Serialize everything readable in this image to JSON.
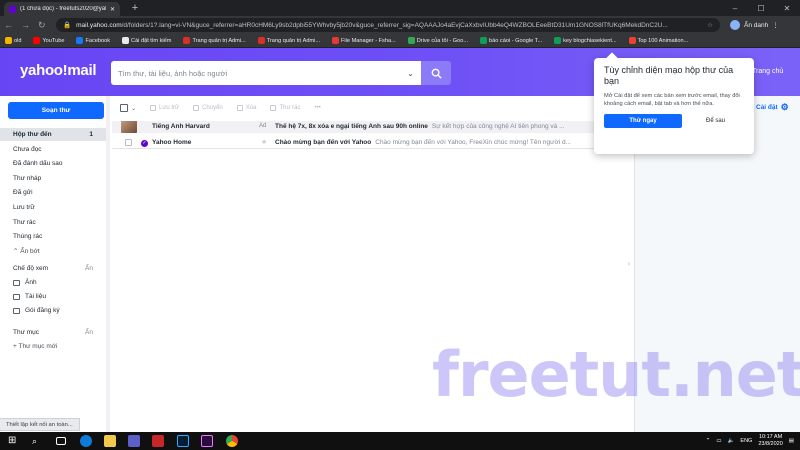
{
  "browser": {
    "tab_title": "(1 chưa đọc) - freetuts2020@yah…",
    "url_domain": "mail.yahoo.com",
    "url_path": "/d/folders/1?.lang=vi-VN&guce_referrer=aHR0cHM6Ly9sb2dpbi55YWhvby5jb20v&guce_referrer_sig=AQAAAJo4aEvjCaXxbvIUbb4eQ4WZBOLEeeBtD31Um1GNOS8lTfUKq6MekdDnC2U...",
    "profile_label": "Ẩn danh",
    "bookmarks": [
      {
        "label": "old",
        "color": "#f4b400"
      },
      {
        "label": "YouTube",
        "color": "#ff0000"
      },
      {
        "label": "Facebook",
        "color": "#1877f2"
      },
      {
        "label": "Cài đặt tìm kiếm",
        "color": "#e8eaed"
      },
      {
        "label": "Trang quản trị Admi...",
        "color": "#d93025"
      },
      {
        "label": "Trang quản trị Admi...",
        "color": "#d93025"
      },
      {
        "label": "File Manager - Fsha...",
        "color": "#e53935"
      },
      {
        "label": "Drive của tôi - Goo...",
        "color": "#34a853"
      },
      {
        "label": "báo cáoi - Google T...",
        "color": "#0f9d58"
      },
      {
        "label": "key blogchiasekient...",
        "color": "#0f9d58"
      },
      {
        "label": "Top 100 Animation...",
        "color": "#ea4335"
      }
    ]
  },
  "header": {
    "logo": "yahoo!mail",
    "search_placeholder": "Tìm thư, tài liệu, ảnh hoặc người",
    "home_link": "Trang chủ"
  },
  "sidebar": {
    "compose": "Soạn thư",
    "folders": [
      {
        "label": "Hộp thư đến",
        "count": "1"
      },
      {
        "label": "Chưa đọc",
        "count": ""
      },
      {
        "label": "Đã đánh dấu sao",
        "count": ""
      },
      {
        "label": "Thư nháp",
        "count": ""
      },
      {
        "label": "Đã gửi",
        "count": ""
      },
      {
        "label": "Lưu trữ",
        "count": ""
      },
      {
        "label": "Thư rác",
        "count": ""
      },
      {
        "label": "Thùng rác",
        "count": ""
      },
      {
        "label": "⌃ Ẩn bớt",
        "count": ""
      }
    ],
    "views_header": "Chế độ xem",
    "views_hide": "Ẩn",
    "views": [
      "Ảnh",
      "Tài liệu",
      "Gói đăng ký"
    ],
    "folders_header": "Thư mục",
    "folders_hide": "Ẩn",
    "new_folder": "+ Thư mục mới"
  },
  "toolbar": {
    "items": [
      "Lưu trữ",
      "Chuyển",
      "Xóa",
      "Thư rác",
      "•••"
    ]
  },
  "messages": [
    {
      "sender": "Tiếng Anh Harvard",
      "ad": "Ad",
      "subject": "Thế hệ 7x, 8x xóa e ngại tiếng Anh sau 90h online",
      "snippet": "Sự kết hợp của công nghệ AI tiên phong và ..."
    },
    {
      "sender": "Yahoo Home",
      "ad": "",
      "subject": "Chào mừng bạn đến với Yahoo",
      "snippet": "Chào mừng bạn đến với Yahoo, FreeXin chúc mừng! Tên người d..."
    }
  ],
  "settings_label": "Cài đặt",
  "popover": {
    "title": "Tùy chỉnh diện mạo hộp thư của bạn",
    "body": "Mở Cài đặt để xem các bản xem trước email, thay đổi khoảng cách email, bật tab và hơn thế nữa.",
    "primary": "Thử ngay",
    "secondary": "Để sau"
  },
  "watermark": "freetut.net",
  "status_text": "Thiết lập kết nối an toàn...",
  "tray": {
    "lang": "ENG",
    "time": "10:17 AM",
    "date": "23/8/2020"
  }
}
